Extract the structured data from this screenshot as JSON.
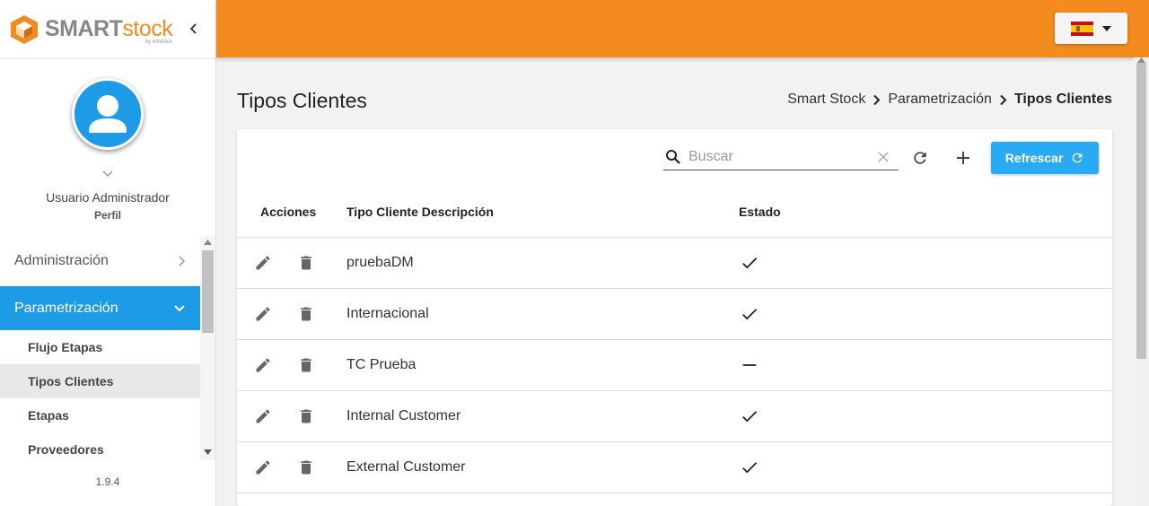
{
  "brand": {
    "smart": "SMART",
    "stock": "stock",
    "sub": "by infotrack"
  },
  "profile": {
    "name": "Usuario Administrador",
    "role": "Perfil"
  },
  "menu": {
    "administracion": "Administración",
    "parametrizacion": "Parametrización",
    "subitems": [
      "Flujo Etapas",
      "Tipos Clientes",
      "Etapas",
      "Proveedores"
    ],
    "selected": "Tipos Clientes"
  },
  "version": "1.9.4",
  "page": {
    "title": "Tipos Clientes",
    "breadcrumb": [
      "Smart Stock",
      "Parametrización",
      "Tipos Clientes"
    ]
  },
  "toolbar": {
    "search_placeholder": "Buscar",
    "refresh_label": "Refrescar"
  },
  "table": {
    "headers": {
      "actions": "Acciones",
      "description": "Tipo Cliente Descripción",
      "status": "Estado"
    },
    "rows": [
      {
        "description": "pruebaDM",
        "active": true
      },
      {
        "description": "Internacional",
        "active": true
      },
      {
        "description": "TC Prueba",
        "active": false
      },
      {
        "description": "Internal Customer",
        "active": true
      },
      {
        "description": "External Customer",
        "active": true
      }
    ]
  },
  "colors": {
    "topbar": "#f38b1f",
    "accent": "#1e9be6",
    "button": "#29aaf4"
  }
}
